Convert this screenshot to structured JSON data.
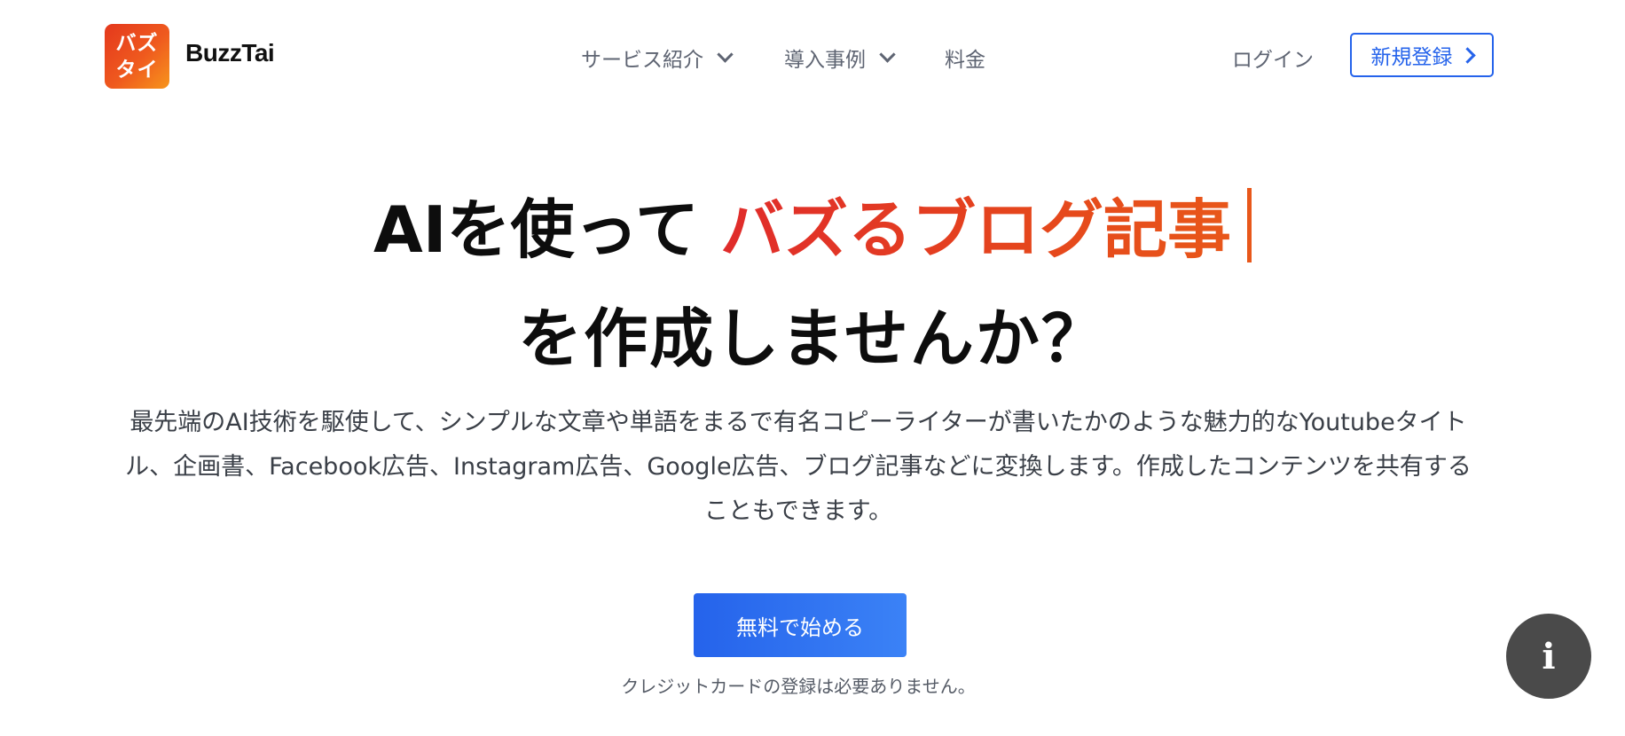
{
  "header": {
    "logo_lines": [
      "バズ",
      "タイ"
    ],
    "brand_name": "BuzzTai",
    "nav": [
      {
        "label": "サービス紹介",
        "has_dropdown": true
      },
      {
        "label": "導入事例",
        "has_dropdown": true
      },
      {
        "label": "料金",
        "has_dropdown": false
      }
    ],
    "login_label": "ログイン",
    "signup_label": "新規登録"
  },
  "hero": {
    "prefix": "AIを使って",
    "accent": "バズるブログ記事",
    "line2": "を作成しませんか？",
    "description": "最先端のAI技術を駆使して、シンプルな文章や単語をまるで有名コピーライターが書いたかのような魅力的なYoutubeタイトル、企画書、Facebook広告、Instagram広告、Google広告、ブログ記事などに変換します。作成したコンテンツを共有することもできます。",
    "cta_label": "無料で始める",
    "note": "クレジットカードの登録は必要ありません。"
  },
  "colors": {
    "accent_gradient_start": "#e02b2b",
    "accent_gradient_end": "#e8571a",
    "primary_blue": "#2563eb",
    "info_button_bg": "#4a4a4a"
  },
  "icons": {
    "dropdown": "chevron-down-icon",
    "signup": "chevron-right-icon",
    "info": "info-icon"
  },
  "info_label": "i"
}
